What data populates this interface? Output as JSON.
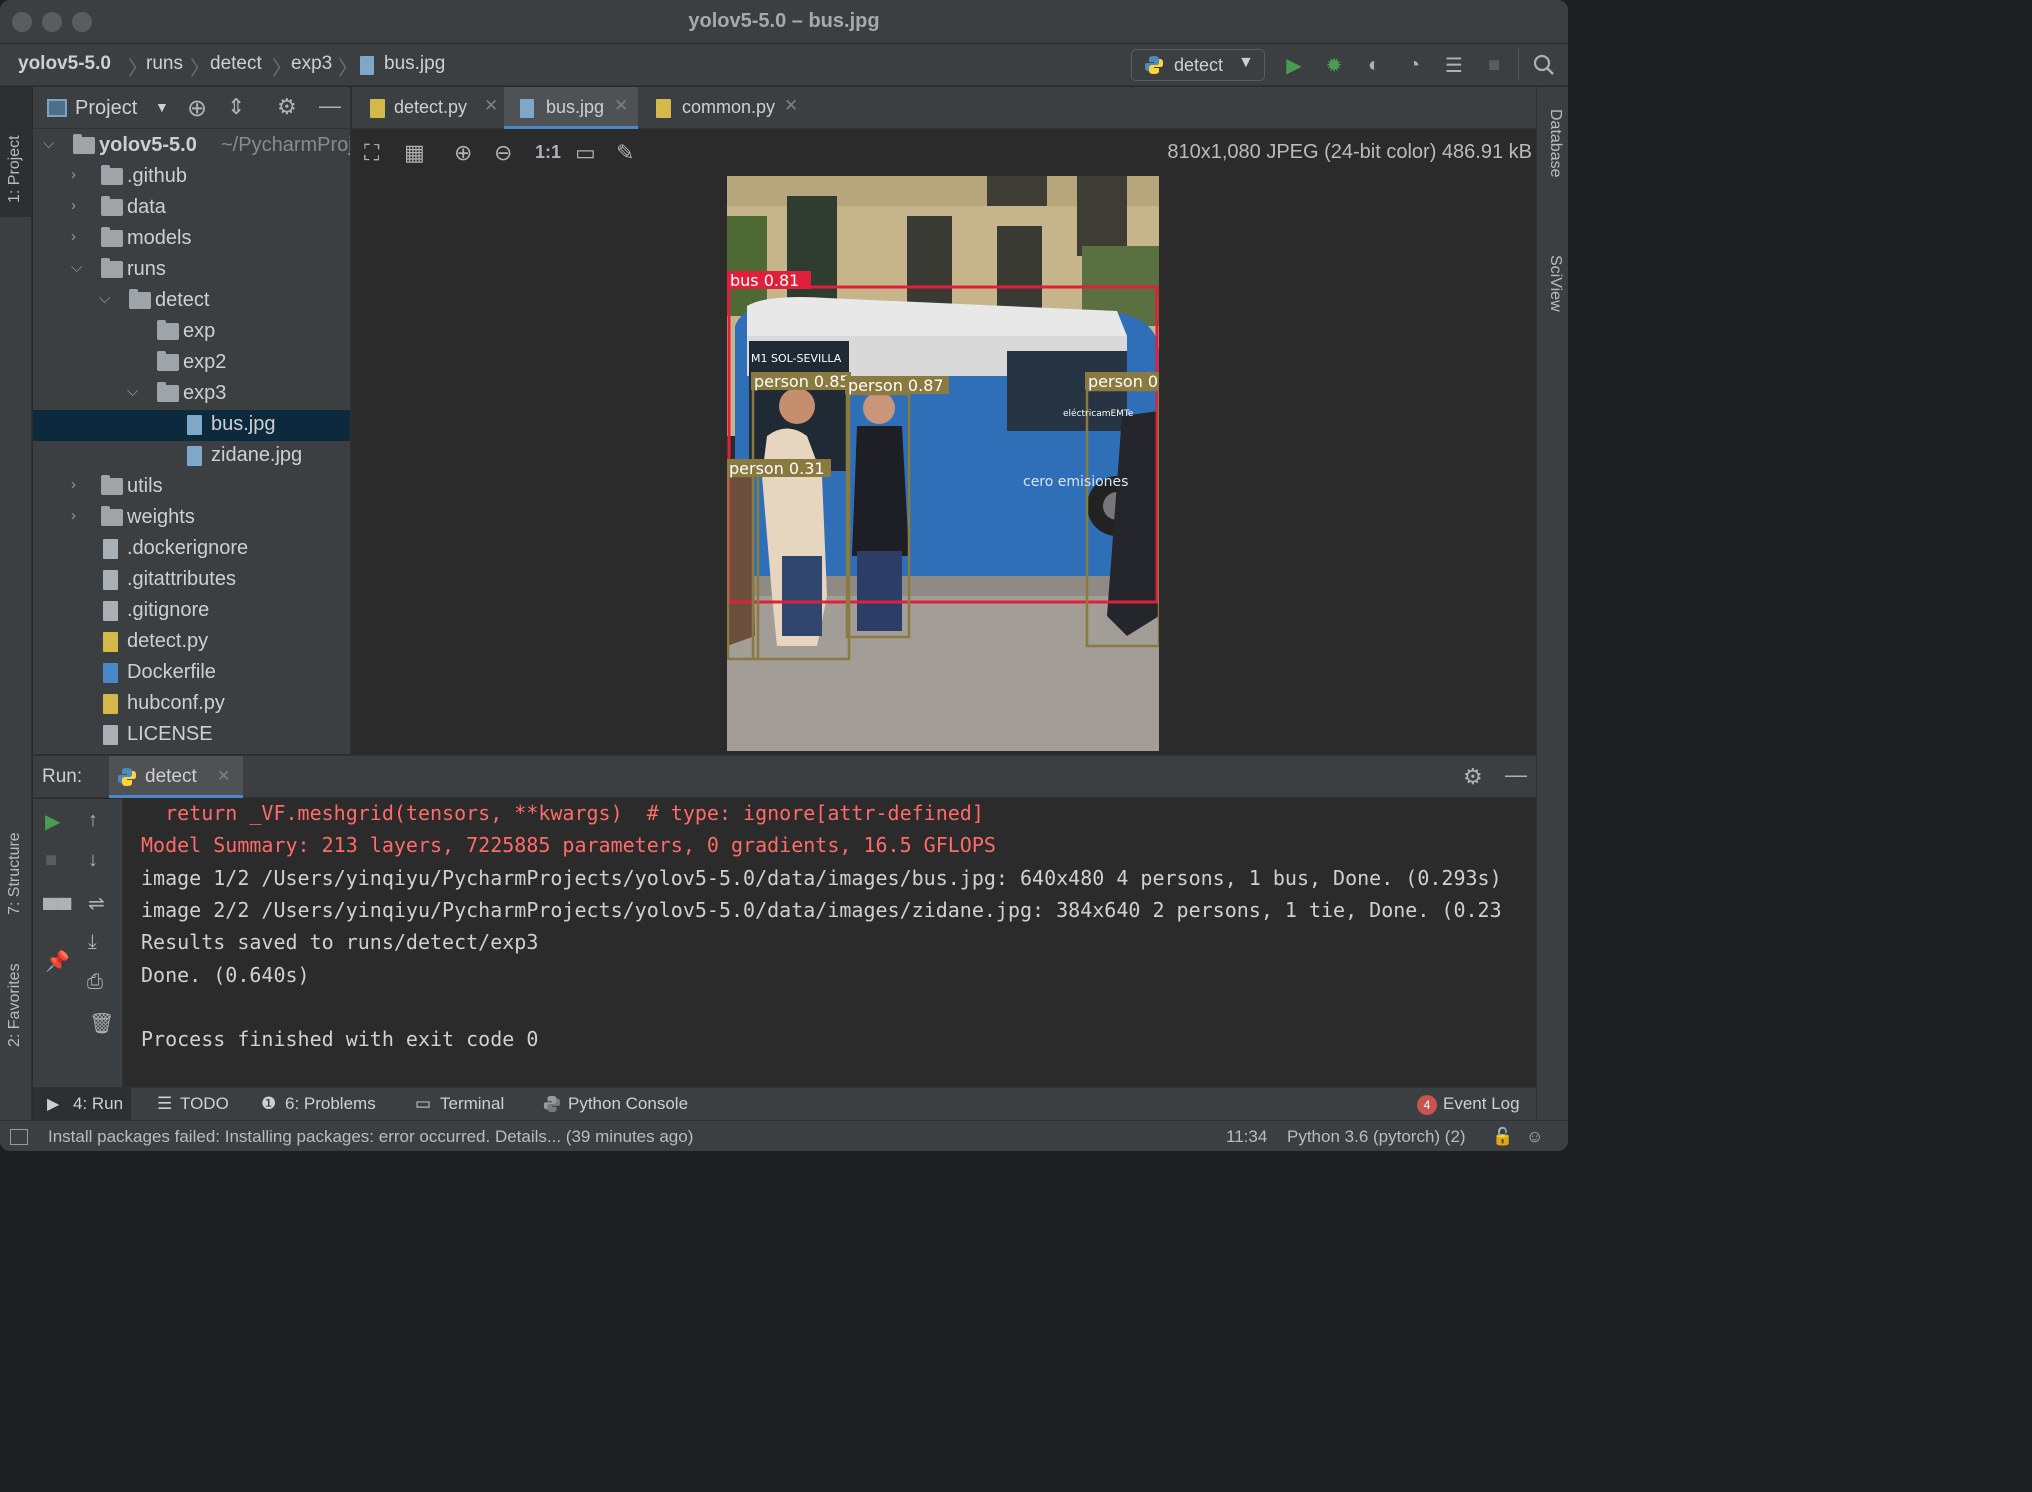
{
  "window": {
    "title": "yolov5-5.0 – bus.jpg"
  },
  "breadcrumb": [
    "yolov5-5.0",
    "runs",
    "detect",
    "exp3",
    "bus.jpg"
  ],
  "toolbar": {
    "run_config": "detect"
  },
  "left_stripe": {
    "project": "1: Project",
    "structure": "7: Structure",
    "favorites": "2: Favorites"
  },
  "right_stripe": {
    "database": "Database",
    "sciview": "SciView"
  },
  "project": {
    "title": "Project",
    "root_name": "yolov5-5.0",
    "root_path": "~/PycharmProjects/yolov5-5.0",
    "items": [
      {
        "label": ".github"
      },
      {
        "label": "data"
      },
      {
        "label": "models"
      },
      {
        "label": "runs"
      },
      {
        "label": "detect"
      },
      {
        "label": "exp"
      },
      {
        "label": "exp2"
      },
      {
        "label": "exp3"
      },
      {
        "label": "bus.jpg"
      },
      {
        "label": "zidane.jpg"
      },
      {
        "label": "utils"
      },
      {
        "label": "weights"
      },
      {
        "label": ".dockerignore"
      },
      {
        "label": ".gitattributes"
      },
      {
        "label": ".gitignore"
      },
      {
        "label": "detect.py"
      },
      {
        "label": "Dockerfile"
      },
      {
        "label": "hubconf.py"
      },
      {
        "label": "LICENSE"
      }
    ]
  },
  "editor": {
    "tabs": [
      {
        "label": "detect.py"
      },
      {
        "label": "bus.jpg"
      },
      {
        "label": "common.py"
      }
    ],
    "zoom_actual": "1:1",
    "image_info": "810x1,080 JPEG (24-bit color) 486.91 kB",
    "detections": [
      {
        "label": "bus 0.81"
      },
      {
        "label": "person 0.85"
      },
      {
        "label": "person 0.87"
      },
      {
        "label": "person 0"
      },
      {
        "label": "person 0.31"
      }
    ],
    "image_text": {
      "bus_route": "M1 SOL-SEVILLA",
      "brand": "cero emisiones",
      "plate": "eléctricamEMTe"
    }
  },
  "run": {
    "label": "Run:",
    "tab": "detect",
    "console": [
      {
        "text": "  return _VF.meshgrid(tensors, **kwargs)  # type: ignore[attr-defined]",
        "type": "err"
      },
      {
        "text": "Model Summary: 213 layers, 7225885 parameters, 0 gradients, 16.5 GFLOPS",
        "type": "err"
      },
      {
        "text": "image 1/2 /Users/yinqiyu/PycharmProjects/yolov5-5.0/data/images/bus.jpg: 640x480 4 persons, 1 bus, Done. (0.293s)",
        "type": "out"
      },
      {
        "text": "image 2/2 /Users/yinqiyu/PycharmProjects/yolov5-5.0/data/images/zidane.jpg: 384x640 2 persons, 1 tie, Done. (0.23",
        "type": "out"
      },
      {
        "text": "Results saved to runs/detect/exp3",
        "type": "out"
      },
      {
        "text": "Done. (0.640s)",
        "type": "out"
      },
      {
        "text": "",
        "type": "out"
      },
      {
        "text": "Process finished with exit code 0",
        "type": "out"
      }
    ]
  },
  "tool_strip": {
    "run": "4: Run",
    "todo": "TODO",
    "problems": "6: Problems",
    "terminal": "Terminal",
    "python_console": "Python Console",
    "event_log_count": "4",
    "event_log": "Event Log"
  },
  "status": {
    "message": "Install packages failed: Installing packages: error occurred. Details... (39 minutes ago)",
    "position": "11:34",
    "interpreter": "Python 3.6 (pytorch) (2)"
  },
  "colors": {
    "accent": "#4a88c7",
    "run_green": "#499c54",
    "error_red": "#ff6b68",
    "bus_box": "#e0203a",
    "person_box": "#8a7a40"
  }
}
